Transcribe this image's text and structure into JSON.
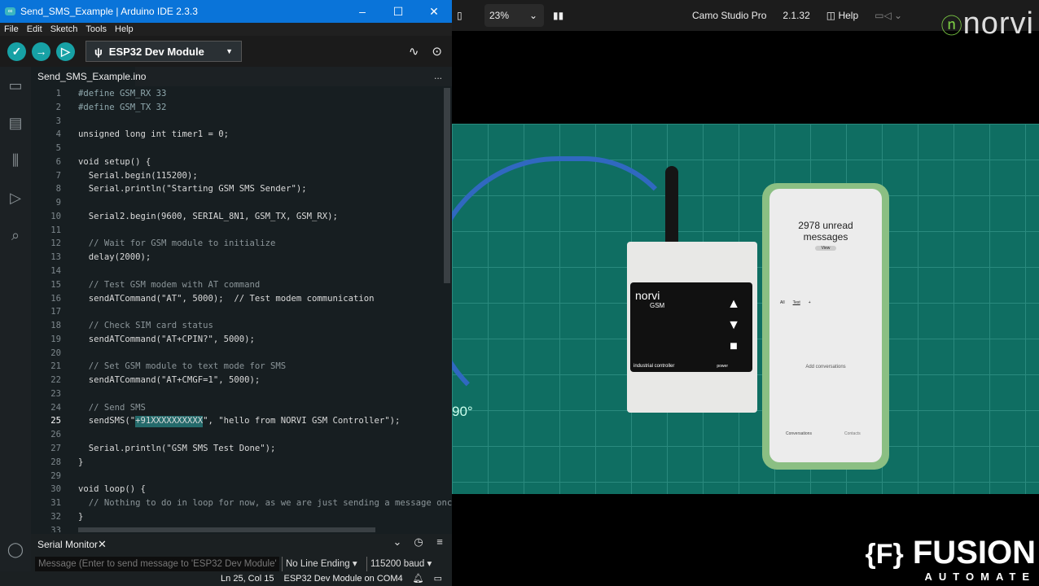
{
  "ide": {
    "window_title": "Send_SMS_Example | Arduino IDE 2.3.3",
    "menu": [
      "File",
      "Edit",
      "Sketch",
      "Tools",
      "Help"
    ],
    "board": "ESP32 Dev Module",
    "file_tab": "Send_SMS_Example.ino",
    "more": "...",
    "code": [
      "#define GSM_RX 33",
      "#define GSM_TX 32",
      "",
      "unsigned long int timer1 = 0;",
      "",
      "void setup() {",
      "  Serial.begin(115200);",
      "  Serial.println(\"Starting GSM SMS Sender\");",
      "",
      "  Serial2.begin(9600, SERIAL_8N1, GSM_TX, GSM_RX);",
      "",
      "  // Wait for GSM module to initialize",
      "  delay(2000);",
      "",
      "  // Test GSM modem with AT command",
      "  sendATCommand(\"AT\", 5000);  // Test modem communication",
      "",
      "  // Check SIM card status",
      "  sendATCommand(\"AT+CPIN?\", 5000);",
      "",
      "  // Set GSM module to text mode for SMS",
      "  sendATCommand(\"AT+CMGF=1\", 5000);",
      "",
      "  // Send SMS",
      "  sendSMS(\"+91XXXXXXXXXX\", \"hello from NORVI GSM Controller\");",
      "",
      "  Serial.println(\"GSM SMS Test Done\");",
      "}",
      "",
      "void loop() {",
      "  // Nothing to do in loop for now, as we are just sending a message once",
      "}",
      ""
    ],
    "current_line": 25,
    "serial_monitor": {
      "title": "Serial Monitor",
      "placeholder": "Message (Enter to send message to 'ESP32 Dev Module' ...",
      "line_ending": "No Line Ending",
      "baud": "115200 baud"
    },
    "status": {
      "position": "Ln 25, Col 15",
      "board_port": "ESP32 Dev Module on COM4"
    }
  },
  "camo": {
    "zoom": "23%",
    "app": "Camo Studio Pro",
    "version": "2.1.32",
    "help": "Help"
  },
  "scene": {
    "device_brand": "norvi",
    "device_label": "GSM",
    "device_caption": "industrial controller",
    "device_power": "power",
    "phone": {
      "unread": "2978 unread messages",
      "view": "View",
      "tab_all": "All",
      "tab_test": "Test",
      "add": "Add conversations",
      "nav_conversations": "Conversations",
      "nav_contacts": "Contacts"
    },
    "angle": "90°"
  },
  "watermarks": {
    "norvi": "norvi",
    "fusion": "FUSION",
    "automate": "AUTOMATE"
  }
}
